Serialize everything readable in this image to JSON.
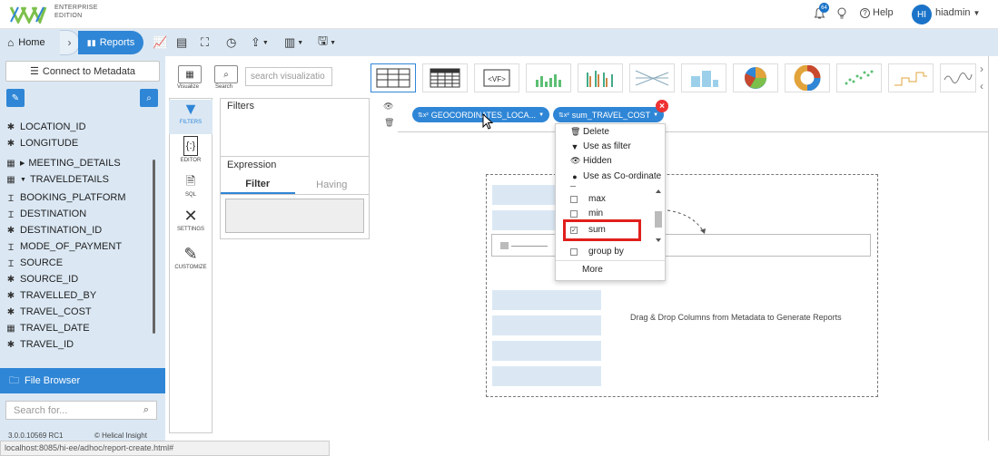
{
  "header": {
    "logo_line1": "ENTERPRISE",
    "logo_line2": "EDITION",
    "notification_count": "64",
    "help_label": "Help",
    "avatar_initials": "HI",
    "username": "hiadmin"
  },
  "nav": {
    "home_label": "Home",
    "reports_label": "Reports"
  },
  "sidebar": {
    "connect_label": "Connect to Metadata",
    "fields": [
      {
        "icon": "gear-icon",
        "label": "LOCATION_ID"
      },
      {
        "icon": "gear-icon",
        "label": "LONGITUDE"
      },
      {
        "icon": "table-icon",
        "label": "MEETING_DETAILS"
      },
      {
        "icon": "table-icon",
        "label": "TRAVELDETAILS"
      },
      {
        "icon": "text-icon",
        "label": "BOOKING_PLATFORM"
      },
      {
        "icon": "text-icon",
        "label": "DESTINATION"
      },
      {
        "icon": "gear-icon",
        "label": "DESTINATION_ID"
      },
      {
        "icon": "text-icon",
        "label": "MODE_OF_PAYMENT"
      },
      {
        "icon": "text-icon",
        "label": "SOURCE"
      },
      {
        "icon": "gear-icon",
        "label": "SOURCE_ID"
      },
      {
        "icon": "gear-icon",
        "label": "TRAVELLED_BY"
      },
      {
        "icon": "gear-icon",
        "label": "TRAVEL_COST"
      },
      {
        "icon": "calendar-icon",
        "label": "TRAVEL_DATE"
      },
      {
        "icon": "gear-icon",
        "label": "TRAVEL_ID"
      }
    ],
    "file_browser_label": "File Browser",
    "search_placeholder": "Search for...",
    "version": "3.0.0.10569 RC1",
    "copyright": "© Helical Insight"
  },
  "viz": {
    "visualize_caption": "Visualize",
    "search_caption": "Search",
    "search_placeholder": "search visualizatio"
  },
  "tools": {
    "filters": "FILTERS",
    "editor": "EDITOR",
    "sql": "SQL",
    "settings": "SETTINGS",
    "customize": "CUSTOMIZE"
  },
  "filters_panel": {
    "title": "Filters",
    "expression_title": "Expression",
    "tab_filter": "Filter",
    "tab_having": "Having"
  },
  "canvas": {
    "pill_geo": "GEOCORDINATES_LOCA...",
    "pill_sum": "sum_TRAVEL_COST",
    "drag_hint": "Drag & Drop Columns from Metadata to Generate Reports"
  },
  "menu": {
    "delete": "Delete",
    "use_as_filter": "Use as filter",
    "hidden": "Hidden",
    "use_as_coordinate": "Use as Co-ordinate",
    "max": "max",
    "min": "min",
    "sum": "sum",
    "group_by": "group by",
    "more": "More"
  },
  "statusbar": {
    "url": "localhost:8085/hi-ee/adhoc/report-create.html#"
  },
  "colors": {
    "accent": "#2f86d6",
    "panel_bg": "#dbe8f4",
    "highlight": "#e0201c"
  }
}
